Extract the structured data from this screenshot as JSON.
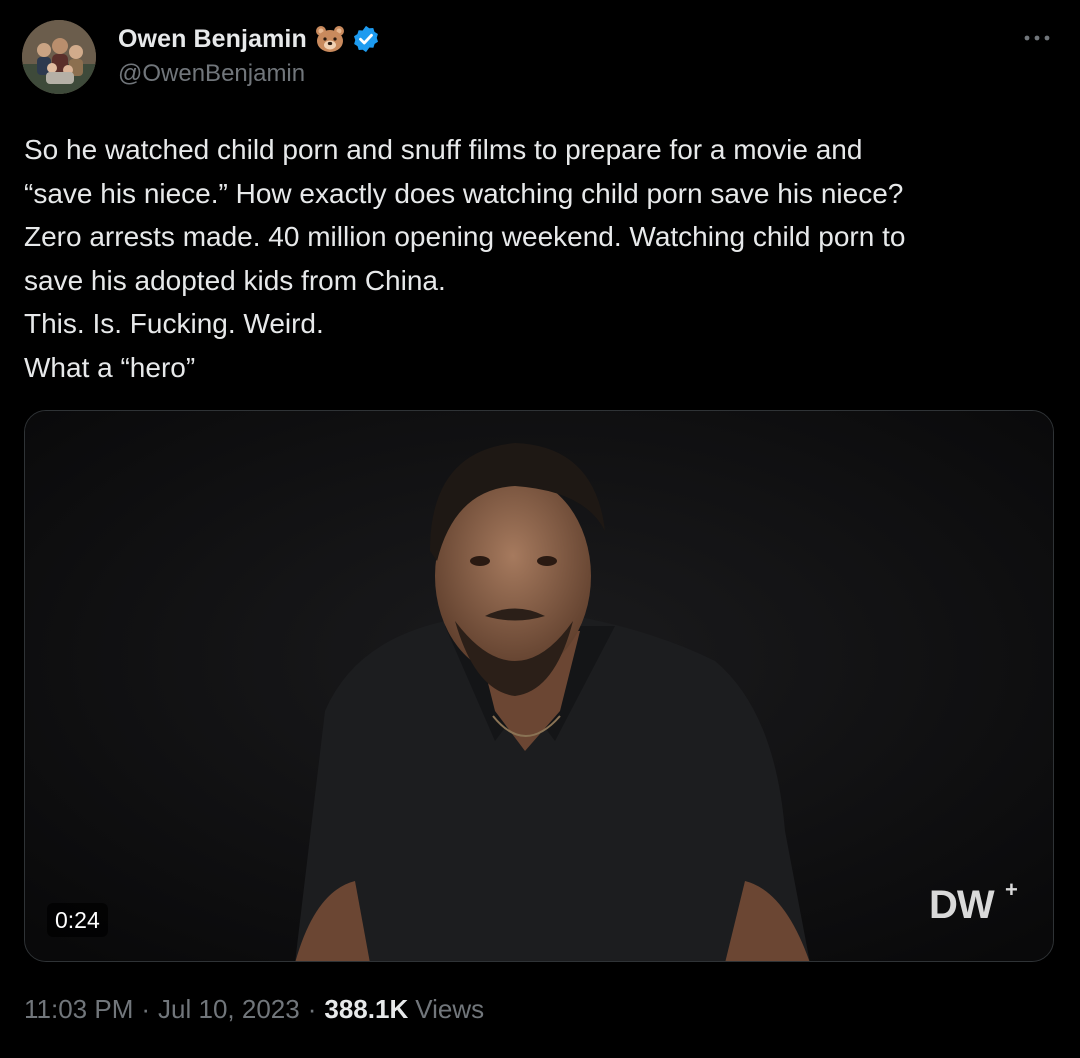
{
  "author": {
    "display_name": "Owen Benjamin",
    "handle": "@OwenBenjamin",
    "badge_emoji_icon": "bear-face-icon",
    "verified_color": "#1d9bf0"
  },
  "tweet": {
    "text": "So he watched child porn and snuff films to prepare for a movie and\n“save his niece.” How exactly does watching child porn save his niece?\nZero arrests made. 40 million opening weekend. Watching child porn to\nsave his adopted kids from China.\nThis. Is. Fucking. Weird.\nWhat a “hero”",
    "time": "11:03 PM",
    "date": "Jul 10, 2023",
    "views_count": "388.1K",
    "views_label": "Views"
  },
  "media": {
    "type": "video",
    "duration": "0:24",
    "watermark": "DW",
    "watermark_plus": "+"
  },
  "colors": {
    "background": "#000000",
    "text_primary": "#e7e9ea",
    "text_secondary": "#71767b",
    "border": "#2f3336"
  }
}
